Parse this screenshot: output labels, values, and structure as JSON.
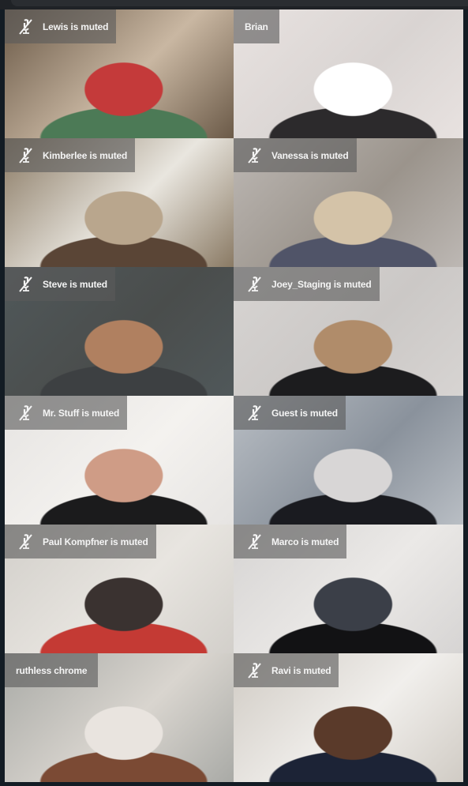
{
  "window": {
    "app": "Video conference"
  },
  "icons": {
    "muted": "mic-off-icon"
  },
  "colors": {
    "active_speaker_border": "#f3e600",
    "background": "#131c24",
    "label_bg": "rgba(90,90,90,0.62)"
  },
  "participants": [
    {
      "name": "Lewis",
      "label": "Lewis is muted",
      "muted": true,
      "active": false,
      "bg": [
        "#6b5a48",
        "#c9b7a2",
        "#4c7a56",
        "#c43a3a"
      ]
    },
    {
      "name": "Brian",
      "label": "Brian",
      "muted": false,
      "active": false,
      "bg": [
        "#e8e2e0",
        "#d9d4d2",
        "#2c2a2c",
        "#ffffff"
      ]
    },
    {
      "name": "Kimberlee",
      "label": "Kimberlee is muted",
      "muted": true,
      "active": false,
      "bg": [
        "#8a7a64",
        "#e9e6df",
        "#5a4536",
        "#b9a68d"
      ]
    },
    {
      "name": "Vanessa",
      "label": "Vanessa is muted",
      "muted": true,
      "active": false,
      "bg": [
        "#bdb8b4",
        "#9b948c",
        "#505468",
        "#d4c3a8"
      ]
    },
    {
      "name": "Steve",
      "label": "Steve is muted",
      "muted": true,
      "active": false,
      "bg": [
        "#50585a",
        "#4a4d4c",
        "#3d4042",
        "#b08060"
      ]
    },
    {
      "name": "Joey_Staging",
      "label": "Joey_Staging is muted",
      "muted": true,
      "active": false,
      "bg": [
        "#d7d4d2",
        "#cbc8c6",
        "#1c1c1e",
        "#b08c6a"
      ]
    },
    {
      "name": "Mr. Stuff",
      "label": "Mr. Stuff is muted",
      "muted": true,
      "active": false,
      "bg": [
        "#e6e4e2",
        "#f4f2ef",
        "#1b1b1c",
        "#cf9c86"
      ]
    },
    {
      "name": "Guest",
      "label": "Guest is muted",
      "muted": true,
      "active": false,
      "bg": [
        "#b9bec4",
        "#8a929c",
        "#1a1b20",
        "#d8d6d6"
      ]
    },
    {
      "name": "Paul Kompfner",
      "label": "Paul Kompfner is muted",
      "muted": true,
      "active": false,
      "bg": [
        "#d2cfca",
        "#e8e5e0",
        "#c43a34",
        "#3a3230"
      ]
    },
    {
      "name": "Marco",
      "label": "Marco is muted",
      "muted": true,
      "active": false,
      "bg": [
        "#d6d4d3",
        "#ebe9e7",
        "#121214",
        "#3b3f48"
      ]
    },
    {
      "name": "ruthless chrome",
      "label": "ruthless chrome",
      "muted": false,
      "active": true,
      "bg": [
        "#a9aaa6",
        "#d9d5cf",
        "#7b4a34",
        "#e9e4df"
      ]
    },
    {
      "name": "Ravi",
      "label": "Ravi is muted",
      "muted": true,
      "active": false,
      "bg": [
        "#d0cbc4",
        "#f1efec",
        "#1c2336",
        "#5a3a2a"
      ]
    }
  ]
}
